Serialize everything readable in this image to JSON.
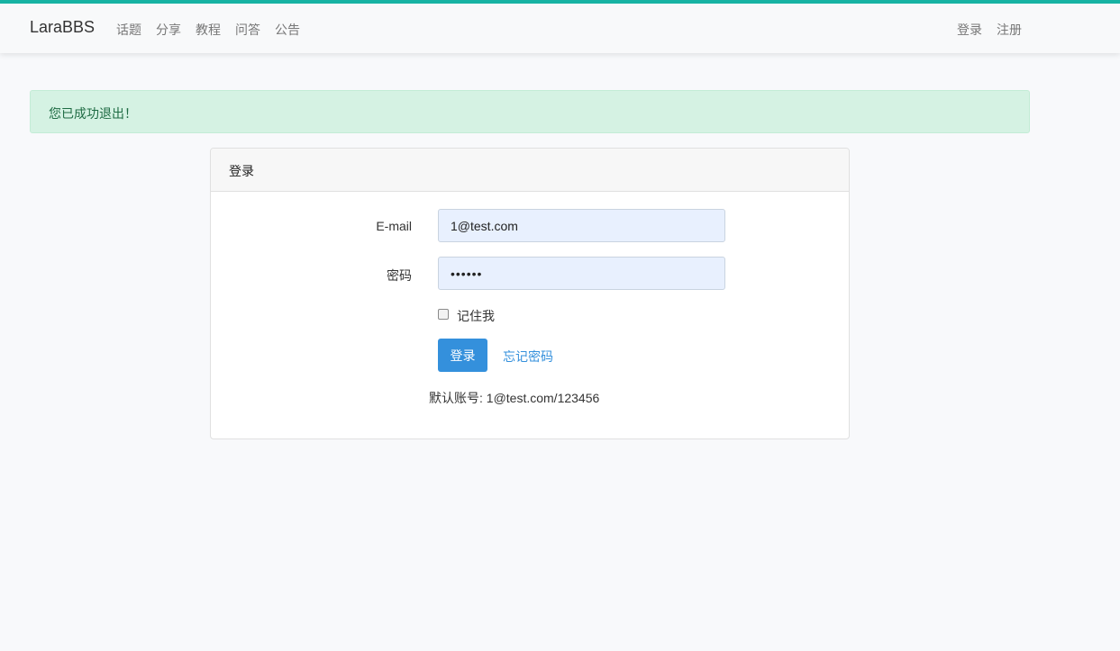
{
  "header": {
    "brand": "LaraBBS",
    "nav": [
      "话题",
      "分享",
      "教程",
      "问答",
      "公告"
    ],
    "auth": {
      "login": "登录",
      "register": "注册"
    }
  },
  "alert": {
    "message": "您已成功退出！"
  },
  "login_card": {
    "title": "登录",
    "email_label": "E-mail",
    "email_value": "1@test.com",
    "password_label": "密码",
    "password_value": "••••••",
    "remember_label": "记住我",
    "submit_label": "登录",
    "forgot_label": "忘记密码",
    "default_account_hint": "默认账号: 1@test.com/123456"
  },
  "colors": {
    "accent_bar": "#17b3a3",
    "primary": "#3490dc",
    "alert_bg": "#d5f2e3",
    "input_autofill_bg": "#e8f0fe"
  }
}
